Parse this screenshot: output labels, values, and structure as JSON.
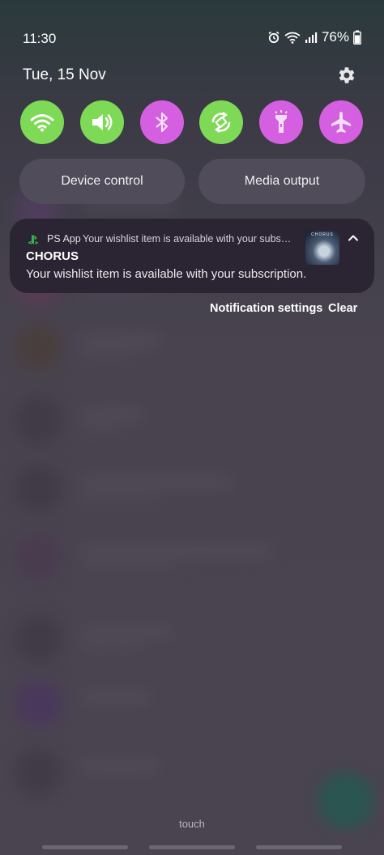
{
  "status_bar": {
    "time": "11:30",
    "battery": "76%"
  },
  "header": {
    "date": "Tue, 15 Nov"
  },
  "quick_settings": [
    {
      "name": "wifi",
      "icon": "wifi-icon",
      "color": "#7ed957",
      "active": true
    },
    {
      "name": "sound",
      "icon": "speaker-icon",
      "color": "#7ed957",
      "active": true
    },
    {
      "name": "bluetooth",
      "icon": "bluetooth-icon",
      "color": "#d45fe0",
      "active": false
    },
    {
      "name": "auto-rotate",
      "icon": "rotate-icon",
      "color": "#7ed957",
      "active": true
    },
    {
      "name": "flashlight",
      "icon": "flashlight-icon",
      "color": "#d45fe0",
      "active": false
    },
    {
      "name": "airplane",
      "icon": "airplane-icon",
      "color": "#d45fe0",
      "active": false
    }
  ],
  "controls": {
    "device_control": "Device control",
    "media_output": "Media output"
  },
  "notification": {
    "app_name": "PS App",
    "summary": "Your wishlist item is available with your subscripti...",
    "title": "CHORUS",
    "body": "Your wishlist item is available with your subscription.",
    "thumb_text": "CHORUS"
  },
  "actions": {
    "settings": "Notification settings",
    "clear": "Clear"
  },
  "footer": {
    "hint": "touch"
  }
}
